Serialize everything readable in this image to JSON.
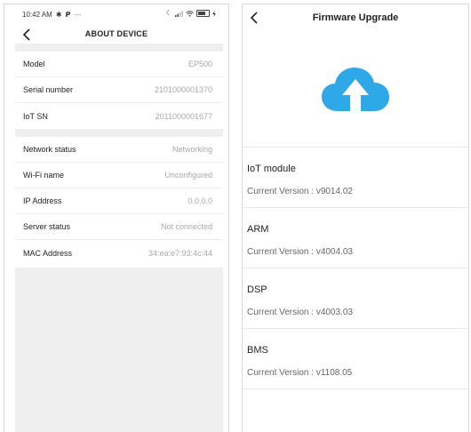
{
  "left": {
    "statusbar": {
      "time": "10:42 AM",
      "left_glyphs": [
        "✱",
        "ᑭ",
        "···"
      ],
      "right_glyphs": [
        "☾",
        "ᐧ",
        "◠"
      ]
    },
    "header": {
      "title": "ABOUT DEVICE"
    },
    "device_info": [
      {
        "label": "Model",
        "value": "EP500"
      },
      {
        "label": "Serial number",
        "value": "2101000001370"
      },
      {
        "label": "IoT SN",
        "value": "2011000001677"
      }
    ],
    "network_info": [
      {
        "label": "Network status",
        "value": "Networking"
      },
      {
        "label": "Wi-Fi name",
        "value": "Unconfigured"
      },
      {
        "label": "IP Address",
        "value": "0.0.0.0"
      },
      {
        "label": "Server status",
        "value": "Not connected"
      },
      {
        "label": "MAC Address",
        "value": "34:ea:e7:93:4c:44"
      }
    ]
  },
  "right": {
    "header": {
      "title": "Firmware Upgrade"
    },
    "hero_icon": "cloud-upload-icon",
    "accent_color": "#2fa8e8",
    "modules": [
      {
        "name": "IoT module",
        "version": "Current Version : v9014.02"
      },
      {
        "name": "ARM",
        "version": "Current Version : v4004.03"
      },
      {
        "name": "DSP",
        "version": "Current Version : v4003.03"
      },
      {
        "name": "BMS",
        "version": "Current Version : v1108.05"
      }
    ]
  }
}
